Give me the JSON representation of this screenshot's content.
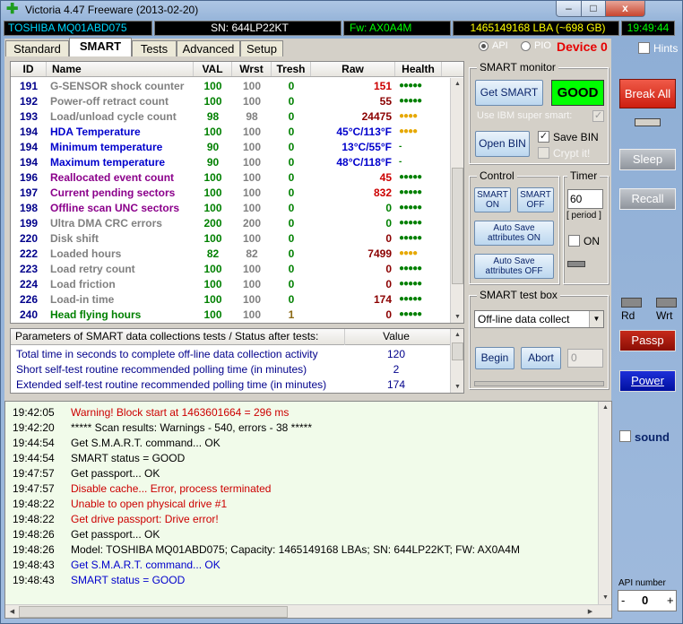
{
  "window": {
    "title": "Victoria 4.47  Freeware (2013-02-20)",
    "min_label": "–",
    "max_label": "□",
    "close_label": "x"
  },
  "info_bar": {
    "drive": "TOSHIBA MQ01ABD075",
    "serial": "SN: 644LP22KT",
    "firmware": "Fw: AX0A4M",
    "capacity": "1465149168 LBA (~698 GB)",
    "clock": "19:49:44"
  },
  "tabs": [
    "Standard",
    "SMART",
    "Tests",
    "Advanced",
    "Setup"
  ],
  "mode": {
    "api_label": "API",
    "pio_label": "PIO",
    "device_label": "Device 0",
    "hints_label": "Hints"
  },
  "smart_table": {
    "headers": [
      "ID",
      "Name",
      "VAL",
      "Wrst",
      "Tresh",
      "Raw",
      "Health"
    ],
    "rows": [
      {
        "id": "191",
        "name": "G-SENSOR shock counter",
        "val": "100",
        "wrst": "100",
        "tresh": "0",
        "raw": "151",
        "health": "●●●●●",
        "name_color": "#808080",
        "raw_color": "#cc0000",
        "health_color": "#008000"
      },
      {
        "id": "192",
        "name": "Power-off retract count",
        "val": "100",
        "wrst": "100",
        "tresh": "0",
        "raw": "55",
        "health": "●●●●●",
        "name_color": "#808080",
        "raw_color": "#8b0000",
        "health_color": "#008000"
      },
      {
        "id": "193",
        "name": "Load/unload cycle count",
        "val": "98",
        "wrst": "98",
        "tresh": "0",
        "raw": "24475",
        "health": "●●●●",
        "name_color": "#808080",
        "raw_color": "#8b0000",
        "health_color": "#e6a800"
      },
      {
        "id": "194",
        "name": "HDA Temperature",
        "val": "100",
        "wrst": "100",
        "tresh": "0",
        "raw": "45°C/113°F",
        "health": "●●●●",
        "name_color": "#0000cc",
        "raw_color": "#0000cc",
        "health_color": "#e6a800"
      },
      {
        "id": "194",
        "name": "Minimum temperature",
        "val": "90",
        "wrst": "100",
        "tresh": "0",
        "raw": "13°C/55°F",
        "health": "-",
        "name_color": "#0000cc",
        "raw_color": "#0000cc",
        "health_color": "#008000"
      },
      {
        "id": "194",
        "name": "Maximum temperature",
        "val": "90",
        "wrst": "100",
        "tresh": "0",
        "raw": "48°C/118°F",
        "health": "-",
        "name_color": "#0000cc",
        "raw_color": "#0000cc",
        "health_color": "#008000"
      },
      {
        "id": "196",
        "name": "Reallocated event count",
        "val": "100",
        "wrst": "100",
        "tresh": "0",
        "raw": "45",
        "health": "●●●●●",
        "name_color": "#8b008b",
        "raw_color": "#cc0000",
        "health_color": "#008000"
      },
      {
        "id": "197",
        "name": "Current pending sectors",
        "val": "100",
        "wrst": "100",
        "tresh": "0",
        "raw": "832",
        "health": "●●●●●",
        "name_color": "#8b008b",
        "raw_color": "#cc0000",
        "health_color": "#008000"
      },
      {
        "id": "198",
        "name": "Offline scan UNC sectors",
        "val": "100",
        "wrst": "100",
        "tresh": "0",
        "raw": "0",
        "health": "●●●●●",
        "name_color": "#8b008b",
        "raw_color": "#008000",
        "health_color": "#008000"
      },
      {
        "id": "199",
        "name": "Ultra DMA CRC errors",
        "val": "200",
        "wrst": "200",
        "tresh": "0",
        "raw": "0",
        "health": "●●●●●",
        "name_color": "#808080",
        "raw_color": "#008000",
        "health_color": "#008000"
      },
      {
        "id": "220",
        "name": "Disk shift",
        "val": "100",
        "wrst": "100",
        "tresh": "0",
        "raw": "0",
        "health": "●●●●●",
        "name_color": "#808080",
        "raw_color": "#8b0000",
        "health_color": "#008000"
      },
      {
        "id": "222",
        "name": "Loaded hours",
        "val": "82",
        "wrst": "82",
        "tresh": "0",
        "raw": "7499",
        "health": "●●●●",
        "name_color": "#808080",
        "raw_color": "#8b0000",
        "health_color": "#e6a800"
      },
      {
        "id": "223",
        "name": "Load retry count",
        "val": "100",
        "wrst": "100",
        "tresh": "0",
        "raw": "0",
        "health": "●●●●●",
        "name_color": "#808080",
        "raw_color": "#8b0000",
        "health_color": "#008000"
      },
      {
        "id": "224",
        "name": "Load friction",
        "val": "100",
        "wrst": "100",
        "tresh": "0",
        "raw": "0",
        "health": "●●●●●",
        "name_color": "#808080",
        "raw_color": "#8b0000",
        "health_color": "#008000"
      },
      {
        "id": "226",
        "name": "Load-in time",
        "val": "100",
        "wrst": "100",
        "tresh": "0",
        "raw": "174",
        "health": "●●●●●",
        "name_color": "#808080",
        "raw_color": "#8b0000",
        "health_color": "#008000"
      },
      {
        "id": "240",
        "name": "Head flying hours",
        "val": "100",
        "wrst": "100",
        "tresh": "1",
        "raw": "0",
        "health": "●●●●●",
        "name_color": "#008000",
        "raw_color": "#8b0000",
        "health_color": "#008000"
      }
    ]
  },
  "smart_monitor": {
    "label": "SMART monitor",
    "get_smart": "Get SMART",
    "status": "GOOD",
    "ibm_label": "Use IBM super smart:",
    "open_bin": "Open BIN",
    "save_bin": "Save BIN",
    "crypt": "Crypt it!"
  },
  "control": {
    "label": "Control",
    "smart_on": [
      "SMART",
      "ON"
    ],
    "smart_off": [
      "SMART",
      "OFF"
    ],
    "autosave_on": [
      "Auto Save",
      "attributes ON"
    ],
    "autosave_off": [
      "Auto Save",
      "attributes OFF"
    ]
  },
  "timer": {
    "label": "Timer",
    "value": "60",
    "period": "[ period ]",
    "on_label": "ON"
  },
  "test_box": {
    "label": "SMART test box",
    "selected": "Off-line data collect",
    "begin": "Begin",
    "abort": "Abort",
    "value": "0"
  },
  "params": {
    "header": "Parameters of SMART data collections tests / Status after tests:",
    "value_header": "Value",
    "rows": [
      {
        "label": "Total time in seconds to complete off-line data collection activity",
        "value": "120"
      },
      {
        "label": "Short self-test routine recommended polling time (in minutes)",
        "value": "2"
      },
      {
        "label": "Extended self-test routine recommended polling time (in minutes)",
        "value": "174"
      }
    ]
  },
  "side": {
    "break_all": "Break All",
    "sleep": "Sleep",
    "recall": "Recall",
    "rd": "Rd",
    "wrt": "Wrt",
    "passp": "Passp",
    "power": "Power",
    "sound": "sound",
    "api_number_label": "API number",
    "api_number": "0",
    "minus": "-",
    "plus": "+"
  },
  "log": [
    {
      "time": "19:42:05",
      "msg": "Warning! Block start at 1463601664 = 296 ms",
      "color": "#cc0000"
    },
    {
      "time": "19:42:20",
      "msg": "***** Scan results: Warnings - 540, errors - 38 *****",
      "color": "#000000"
    },
    {
      "time": "19:44:54",
      "msg": "Get S.M.A.R.T. command... OK",
      "color": "#000000"
    },
    {
      "time": "19:44:54",
      "msg": "SMART status = GOOD",
      "color": "#000000"
    },
    {
      "time": "19:47:57",
      "msg": "Get passport... OK",
      "color": "#000000"
    },
    {
      "time": "19:47:57",
      "msg": "Disable cache... Error, process terminated",
      "color": "#cc0000"
    },
    {
      "time": "19:48:22",
      "msg": "Unable to open physical drive #1",
      "color": "#cc0000"
    },
    {
      "time": "19:48:22",
      "msg": "Get drive passport: Drive error!",
      "color": "#cc0000"
    },
    {
      "time": "19:48:26",
      "msg": "Get passport... OK",
      "color": "#000000"
    },
    {
      "time": "19:48:26",
      "msg": "Model: TOSHIBA MQ01ABD075; Capacity: 1465149168 LBAs; SN: 644LP22KT; FW: AX0A4M",
      "color": "#000000"
    },
    {
      "time": "19:48:43",
      "msg": "Get S.M.A.R.T. command... OK",
      "color": "#0000cc"
    },
    {
      "time": "19:48:43",
      "msg": "SMART status = GOOD",
      "color": "#0000cc"
    }
  ]
}
